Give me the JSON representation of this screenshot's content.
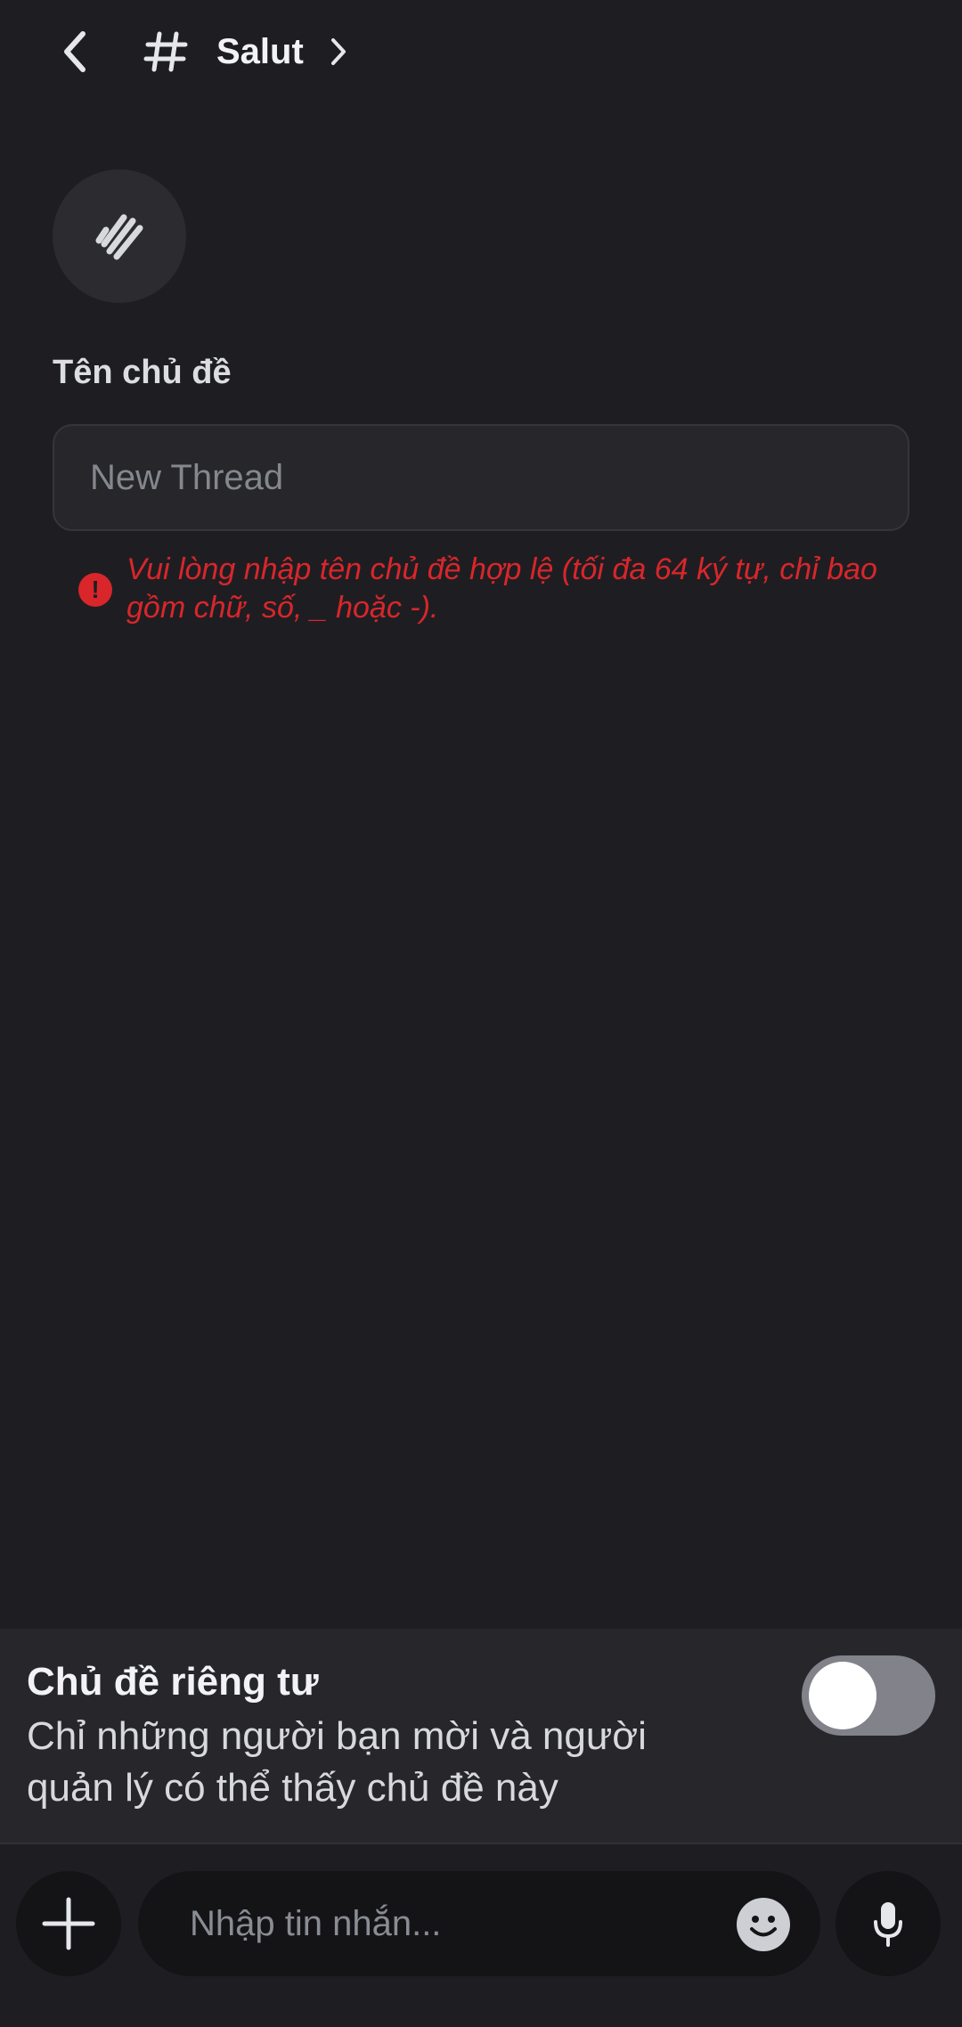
{
  "header": {
    "channel_name": "Salut",
    "back_icon": "chevron-left-icon",
    "channel_icon": "hash-icon",
    "chevron_icon": "chevron-right-icon"
  },
  "thread": {
    "avatar_icon": "thread-icon",
    "name_label": "Tên chủ đề",
    "name_placeholder": "New Thread",
    "name_value": "",
    "error_icon": "alert-circle-icon",
    "error_text": "Vui lòng nhập tên chủ đề hợp lệ (tối đa 64 ký tự, chỉ bao gồm chữ, số, _ hoặc -)."
  },
  "private": {
    "title": "Chủ đề riêng tư",
    "description": "Chỉ những người bạn mời và người quản lý có thể thấy chủ đề này",
    "enabled": false
  },
  "composer": {
    "placeholder": "Nhập tin nhắn...",
    "add_icon": "plus-icon",
    "emoji_icon": "emoji-icon",
    "mic_icon": "microphone-icon"
  },
  "colors": {
    "background": "#1e1e22",
    "error": "#d9262b",
    "panel": "#27272b",
    "toggle_off": "#81828a"
  }
}
